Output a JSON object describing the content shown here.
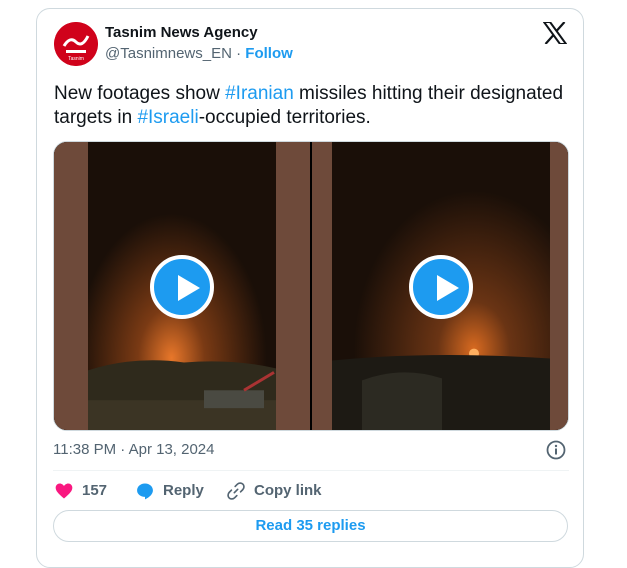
{
  "account": {
    "name": "Tasnim News Agency",
    "handle": "@Tasnimnews_EN",
    "separator": "·",
    "follow_label": "Follow"
  },
  "tweet": {
    "text_1": "New footages show ",
    "hashtag_1": "#Iranian",
    "text_2": " missiles hitting their designated targets in ",
    "hashtag_2": "#Israeli",
    "text_3": "-occupied territories."
  },
  "media": {
    "videos": [
      {
        "label": "video-1"
      },
      {
        "label": "video-2"
      }
    ]
  },
  "meta": {
    "timestamp": "11:38 PM · Apr 13, 2024"
  },
  "actions": {
    "like_count": "157",
    "reply_label": "Reply",
    "copy_link_label": "Copy link",
    "read_replies_label": "Read 35 replies"
  },
  "colors": {
    "accent": "#1d9bf0",
    "like": "#f91880",
    "text_secondary": "#536471",
    "border": "#cfd9de"
  }
}
